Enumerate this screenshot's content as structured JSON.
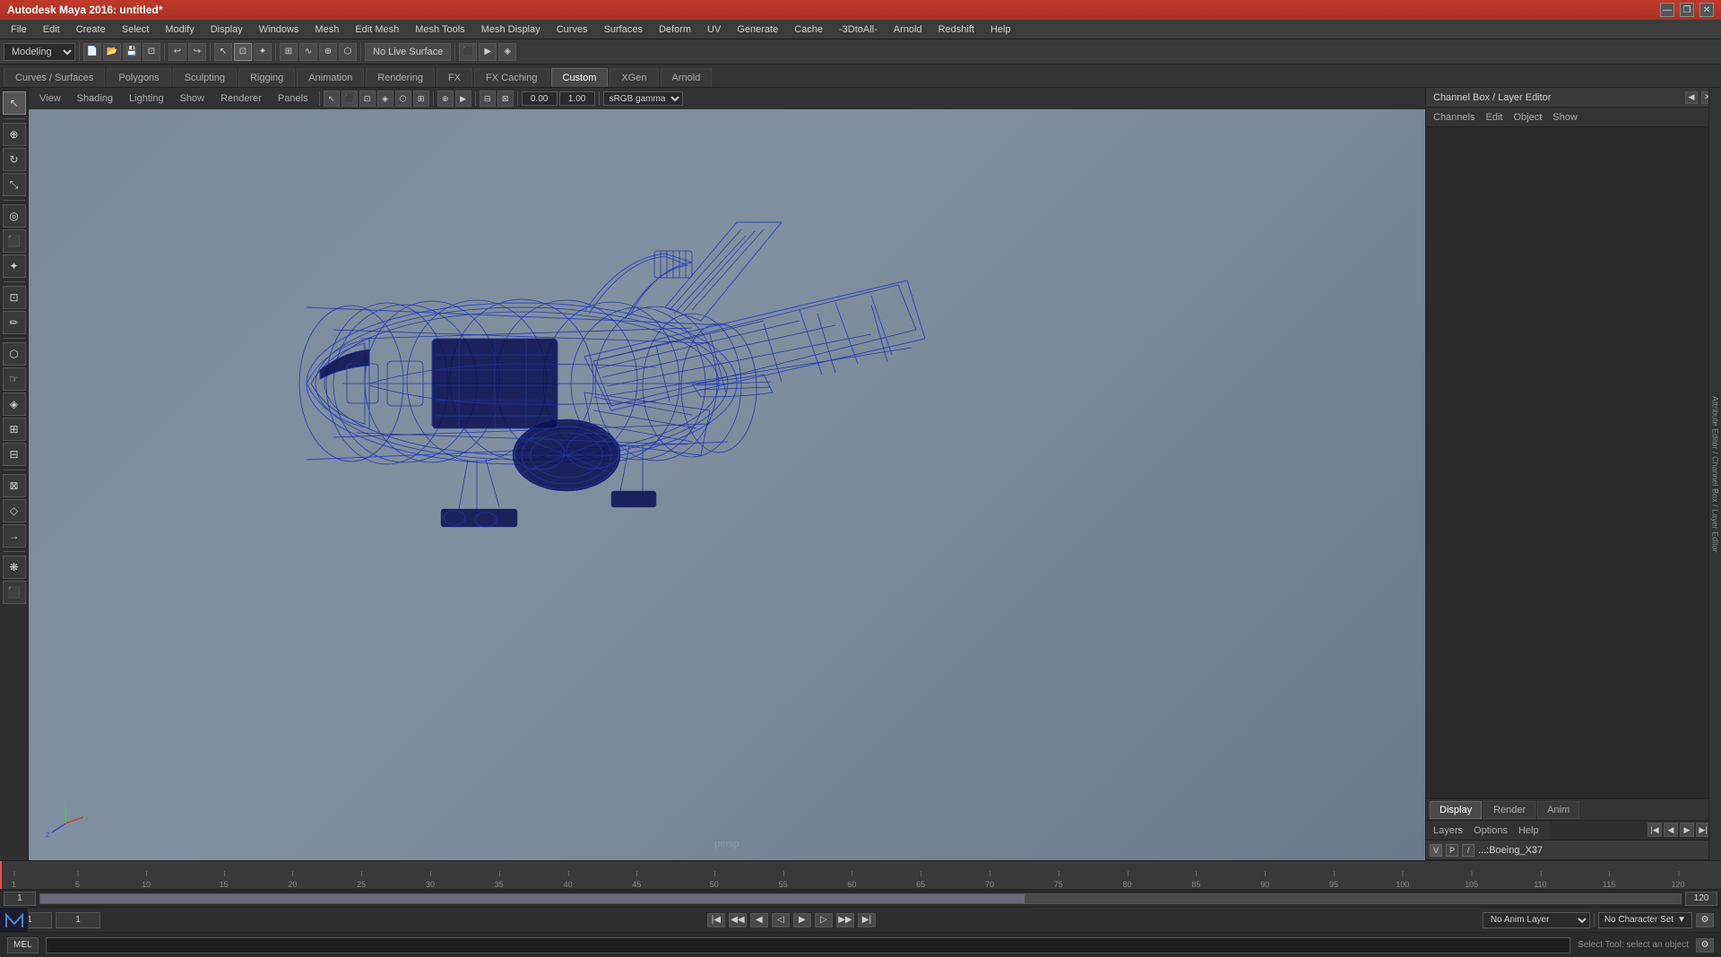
{
  "title_bar": {
    "title": "Autodesk Maya 2016: untitled*",
    "min_btn": "—",
    "restore_btn": "❐",
    "close_btn": "✕"
  },
  "menu_bar": {
    "items": [
      "File",
      "Edit",
      "Create",
      "Select",
      "Modify",
      "Display",
      "Windows",
      "Mesh",
      "Edit Mesh",
      "Mesh Tools",
      "Mesh Display",
      "Curves",
      "Surfaces",
      "Deform",
      "UV",
      "Generate",
      "Cache",
      "-3DtoAll-",
      "Arnold",
      "Redshift",
      "Help"
    ]
  },
  "toolbar": {
    "workspace_dropdown": "Modeling",
    "live_surface": "No Live Surface",
    "gamma_label": "sRGB gamma"
  },
  "workspaces": {
    "tabs": [
      "Curves / Surfaces",
      "Polygons",
      "Sculpting",
      "Rigging",
      "Animation",
      "Rendering",
      "FX",
      "FX Caching",
      "Custom",
      "XGen",
      "Arnold"
    ],
    "active": "Custom"
  },
  "viewport": {
    "view_tabs": [
      "View",
      "Shading",
      "Lighting",
      "Show",
      "Renderer",
      "Panels"
    ],
    "persp_label": "persp",
    "field1_value": "0.00",
    "field2_value": "1.00",
    "gamma": "sRGB gamma"
  },
  "right_panel": {
    "title": "Channel Box / Layer Editor",
    "channel_menu": [
      "Channels",
      "Edit",
      "Object",
      "Show"
    ]
  },
  "display_tabs": {
    "tabs": [
      "Display",
      "Render",
      "Anim"
    ],
    "active": "Display"
  },
  "layers": {
    "menu_items": [
      "Layers",
      "Options",
      "Help"
    ],
    "layer_name": "Boeing_X37",
    "layer_v": "V",
    "layer_p": "P",
    "layer_icon": "/"
  },
  "timeline": {
    "start": "1",
    "end": "120",
    "ticks": [
      "1",
      "5",
      "10",
      "15",
      "20",
      "25",
      "30",
      "35",
      "40",
      "45",
      "50",
      "55",
      "60",
      "65",
      "70",
      "75",
      "80",
      "85",
      "90",
      "95",
      "100",
      "105",
      "110",
      "115",
      "120"
    ]
  },
  "range_bar": {
    "start_field": "1",
    "end_field": "120",
    "current": "1"
  },
  "anim_bar": {
    "anim_layer": "No Anim Layer",
    "char_set": "No Character Set",
    "field1": "1",
    "field2": "1"
  },
  "status_bar": {
    "lang": "MEL",
    "message": "Select Tool: select an object"
  },
  "attr_sidebar": {
    "label": "Attribute Editor / Channel Box / Layer Editor"
  },
  "left_tools": {
    "tools": [
      "↖",
      "⟳",
      "⟲",
      "↔",
      "✦",
      "⬡",
      "◈",
      "⬛",
      "⊡",
      "⊞",
      "⊟",
      "⊠",
      "⊕"
    ]
  },
  "colors": {
    "accent_red": "#c0392b",
    "bg_dark": "#2a2a2a",
    "bg_medium": "#3a3a3a",
    "text_normal": "#cccccc",
    "active_tab": "#4a4a4a",
    "wireframe_blue": "#1a2a8a",
    "viewport_bg_top": "#7a8a9a",
    "viewport_bg_bottom": "#6a7a8a"
  }
}
